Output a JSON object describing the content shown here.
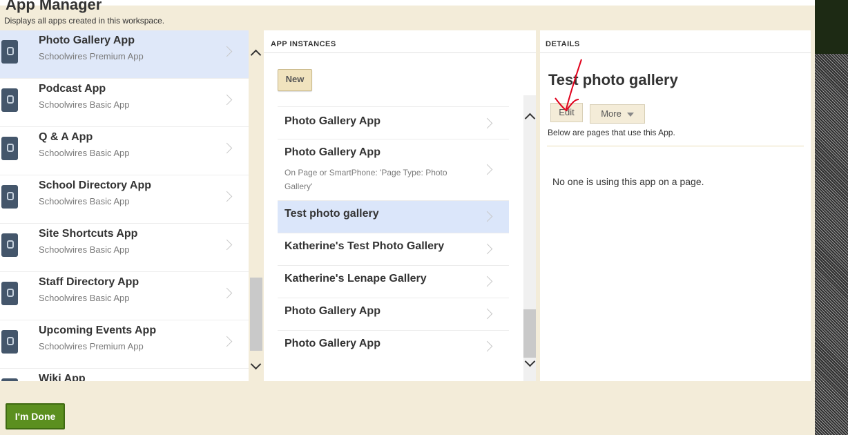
{
  "header": {
    "title": "App Manager",
    "subtitle": "Displays all apps created in this workspace."
  },
  "apps": [
    {
      "name": "Photo Gallery App",
      "type": "Schoolwires Premium App"
    },
    {
      "name": "Podcast App",
      "type": "Schoolwires Basic App"
    },
    {
      "name": "Q & A App",
      "type": "Schoolwires Basic App"
    },
    {
      "name": "School Directory App",
      "type": "Schoolwires Basic App"
    },
    {
      "name": "Site Shortcuts App",
      "type": "Schoolwires Basic App"
    },
    {
      "name": "Staff Directory App",
      "type": "Schoolwires Basic App"
    },
    {
      "name": "Upcoming Events App",
      "type": "Schoolwires Premium App"
    },
    {
      "name": "Wiki App",
      "type": ""
    }
  ],
  "instances": {
    "header": "APP INSTANCES",
    "new_label": "New",
    "items": [
      {
        "name": "Photo Gallery App",
        "desc": ""
      },
      {
        "name": "Photo Gallery App",
        "desc": "On Page or SmartPhone: 'Page Type: Photo Gallery'"
      },
      {
        "name": "Test photo gallery",
        "desc": ""
      },
      {
        "name": "Katherine's Test Photo Gallery",
        "desc": ""
      },
      {
        "name": "Katherine's Lenape Gallery",
        "desc": ""
      },
      {
        "name": "Photo Gallery App",
        "desc": ""
      },
      {
        "name": "Photo Gallery App",
        "desc": ""
      }
    ]
  },
  "details": {
    "header": "DETAILS",
    "title": "Test photo gallery",
    "edit_label": "Edit",
    "more_label": "More",
    "below_text": "Below are pages that use this App.",
    "empty_text": "No one is using this app on a page."
  },
  "footer": {
    "done_label": "I'm Done"
  },
  "colors": {
    "panel_bg": "#f3ecd9",
    "selected_bg": "#dfe8f9",
    "done_green": "#5b8f1f",
    "annotation_red": "#e0001b"
  }
}
